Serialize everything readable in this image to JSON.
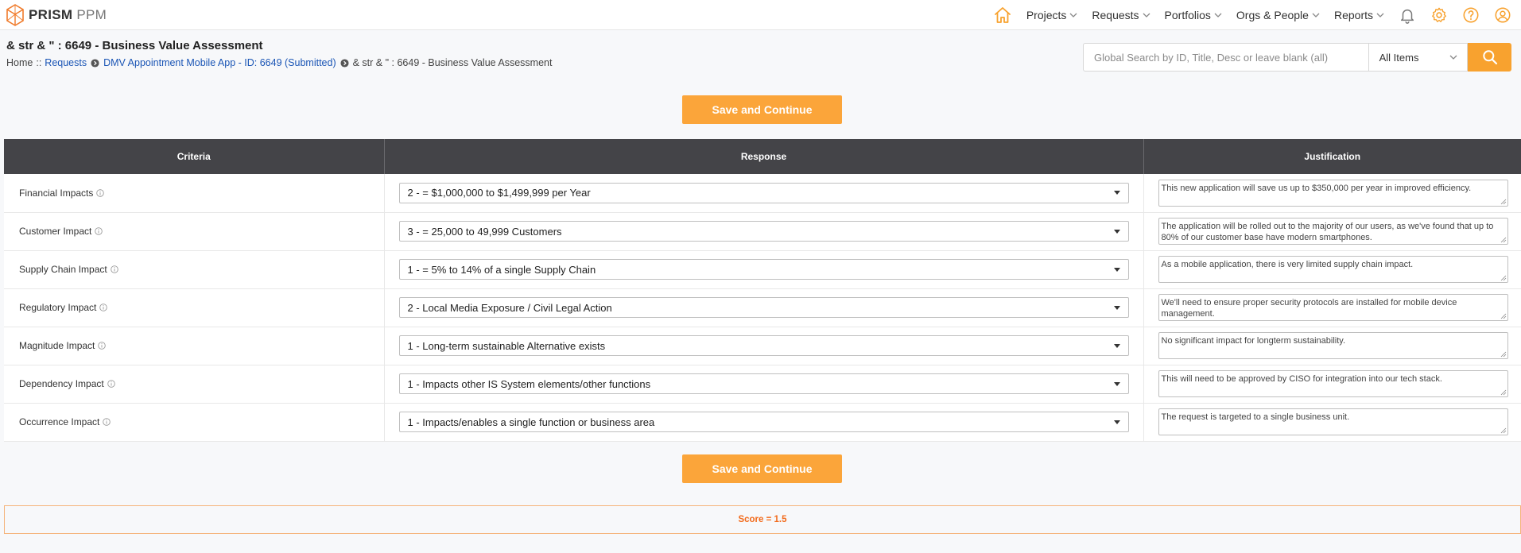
{
  "app": {
    "brand_bold": "PRISM",
    "brand_light": "PPM"
  },
  "nav": {
    "items": [
      {
        "label": "Projects"
      },
      {
        "label": "Requests"
      },
      {
        "label": "Portfolios"
      },
      {
        "label": "Orgs & People"
      },
      {
        "label": "Reports"
      }
    ],
    "icons": [
      "home-icon",
      "bell-icon",
      "gear-icon",
      "help-icon",
      "user-icon"
    ],
    "accent": "#f8a22f"
  },
  "page": {
    "title": "& str & \" : 6649 - Business Value Assessment",
    "breadcrumb": {
      "home": "Home",
      "sep": "::",
      "requests": "Requests",
      "request_link": "DMV Appointment Mobile App - ID: 6649 (Submitted)",
      "current": "& str & \" : 6649 - Business Value Assessment"
    }
  },
  "search": {
    "placeholder": "Global Search by ID, Title, Desc or leave blank (all)",
    "value": "",
    "scope": "All Items"
  },
  "actions": {
    "save_label": "Save and Continue"
  },
  "table": {
    "headers": {
      "criteria": "Criteria",
      "response": "Response",
      "justification": "Justification"
    },
    "rows": [
      {
        "criteria": "Financial Impacts",
        "response": "2 - = $1,000,000 to $1,499,999 per Year",
        "justification": "This new application will save us up to $350,000 per year in improved efficiency."
      },
      {
        "criteria": "Customer Impact",
        "response": "3 - = 25,000 to 49,999 Customers",
        "justification": "The application will be rolled out to the majority of our users, as we've found that up to 80% of our customer base have modern smartphones."
      },
      {
        "criteria": "Supply Chain Impact",
        "response": "1 - = 5% to 14% of a single Supply Chain",
        "justification": "As a mobile application, there is very limited supply chain impact."
      },
      {
        "criteria": "Regulatory Impact",
        "response": "2 - Local Media Exposure / Civil Legal Action",
        "justification": "We'll need to ensure proper security protocols are installed for mobile device management."
      },
      {
        "criteria": "Magnitude Impact",
        "response": "1 - Long-term sustainable Alternative exists",
        "justification": "No significant impact for longterm sustainability."
      },
      {
        "criteria": "Dependency Impact",
        "response": "1 - Impacts other IS System elements/other functions",
        "justification": "This will need to be approved by CISO for integration into our tech stack."
      },
      {
        "criteria": "Occurrence Impact",
        "response": "1 - Impacts/enables a single function or business area",
        "justification": "The request is targeted to a single business unit."
      }
    ]
  },
  "score": {
    "text": "Score = 1.5",
    "color": "#f26a1b"
  }
}
